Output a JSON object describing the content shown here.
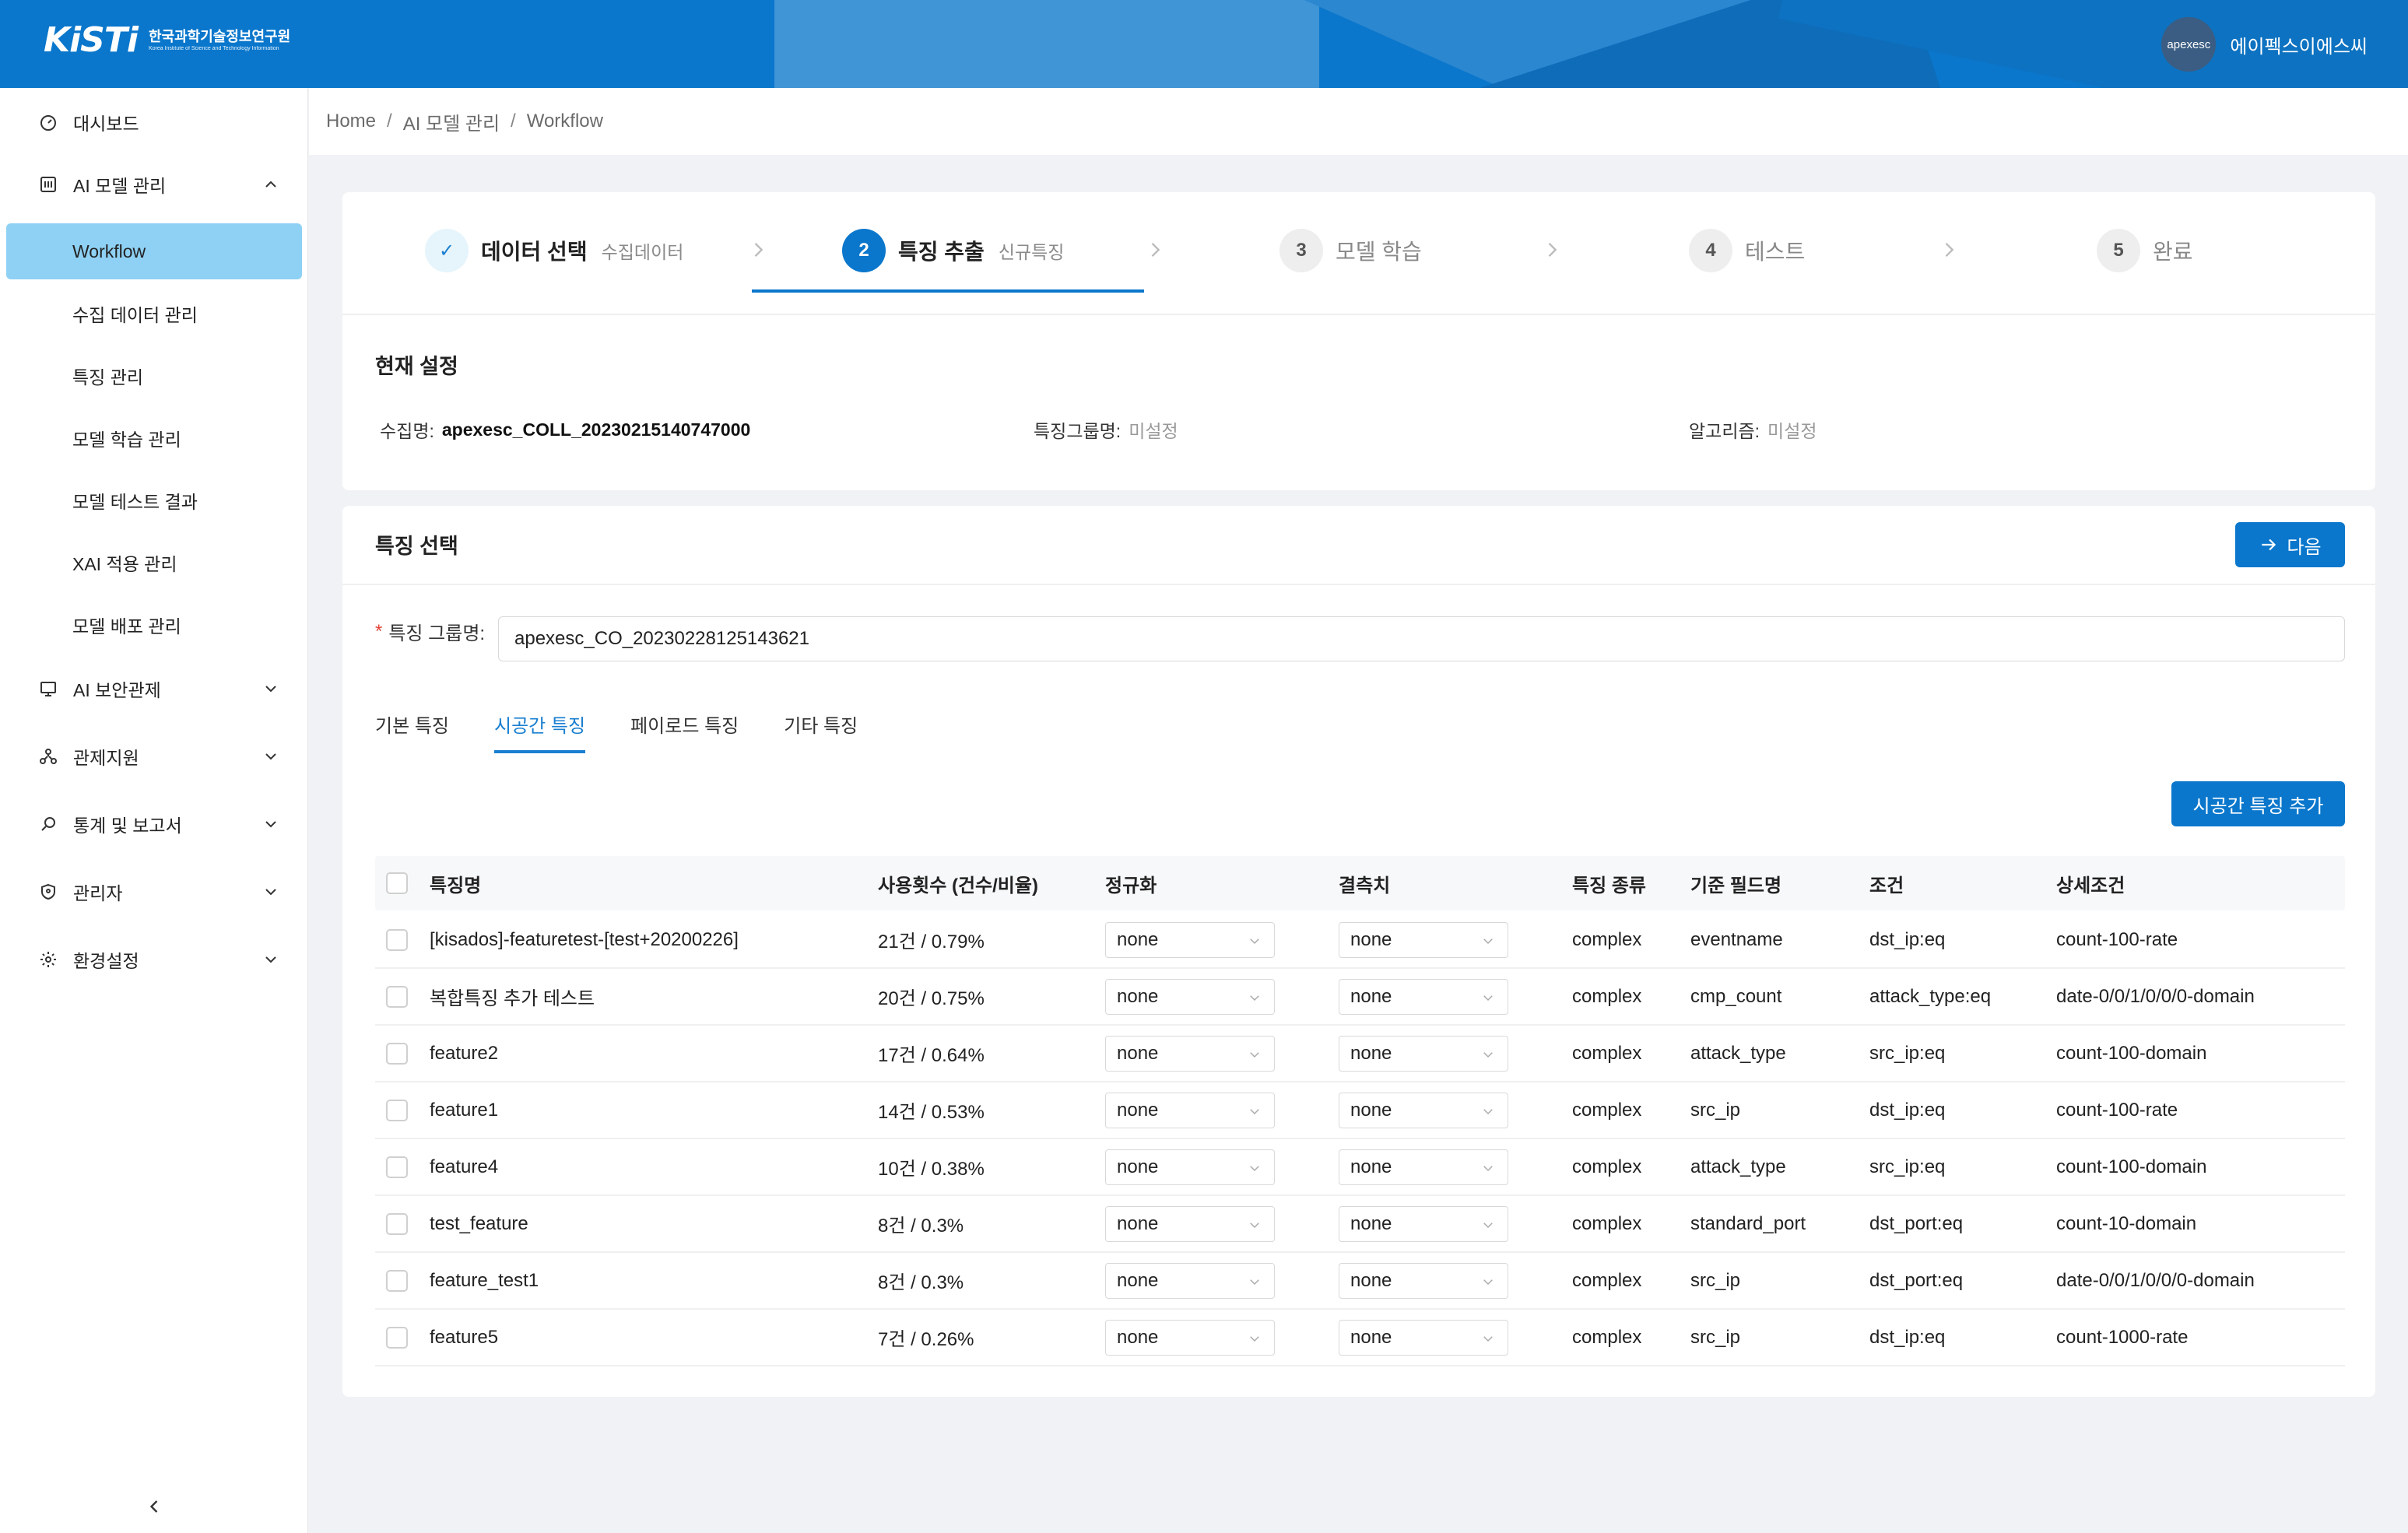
{
  "header": {
    "logo_mark": "KiSTi",
    "logo_korean": "한국과학기술정보연구원",
    "logo_english": "Korea Institute of Science and Technology Information",
    "avatar_text": "apexesc",
    "user_name": "에이펙스이에스씨"
  },
  "sidebar": {
    "items": [
      {
        "label": "대시보드",
        "icon": "dashboard-icon"
      },
      {
        "label": "AI 모델 관리",
        "icon": "ai-model-icon",
        "expanded": true
      },
      {
        "label": "AI 보안관제",
        "icon": "monitor-icon"
      },
      {
        "label": "관제지원",
        "icon": "network-icon"
      },
      {
        "label": "통계 및 보고서",
        "icon": "search-report-icon"
      },
      {
        "label": "관리자",
        "icon": "shield-icon"
      },
      {
        "label": "환경설정",
        "icon": "gear-icon"
      }
    ],
    "sub_items": [
      {
        "label": "Workflow",
        "active": true
      },
      {
        "label": "수집 데이터 관리"
      },
      {
        "label": "특징 관리"
      },
      {
        "label": "모델 학습 관리"
      },
      {
        "label": "모델 테스트 결과"
      },
      {
        "label": "XAI 적용 관리"
      },
      {
        "label": "모델 배포 관리"
      }
    ]
  },
  "breadcrumb": [
    "Home",
    "AI 모델 관리",
    "Workflow"
  ],
  "steps": [
    {
      "num": "✓",
      "title": "데이터 선택",
      "desc": "수집데이터",
      "state": "done"
    },
    {
      "num": "2",
      "title": "특징 추출",
      "desc": "신규특징",
      "state": "active"
    },
    {
      "num": "3",
      "title": "모델 학습",
      "desc": "",
      "state": "wait"
    },
    {
      "num": "4",
      "title": "테스트",
      "desc": "",
      "state": "wait"
    },
    {
      "num": "5",
      "title": "완료",
      "desc": "",
      "state": "wait"
    }
  ],
  "current_settings": {
    "title": "현재 설정",
    "collection_label": "수집명:",
    "collection_value": "apexesc_COLL_20230215140747000",
    "feature_group_label": "특징그룹명:",
    "feature_group_value": "미설정",
    "algorithm_label": "알고리즘:",
    "algorithm_value": "미설정"
  },
  "feature_select": {
    "title": "특징 선택",
    "next_button": "다음",
    "group_label": "특징 그룹명:",
    "group_value": "apexesc_CO_20230228125143621",
    "tabs": [
      "기본 특징",
      "시공간 특징",
      "페이로드 특징",
      "기타 특징"
    ],
    "active_tab": 1,
    "add_button": "시공간 특징 추가"
  },
  "table": {
    "columns": [
      "특징명",
      "사용횟수 (건수/비율)",
      "정규화",
      "결측치",
      "특징 종류",
      "기준 필드명",
      "조건",
      "상세조건"
    ],
    "rows": [
      {
        "name": "[kisados]-featuretest-[test+20200226]",
        "usage": "21건 / 0.79%",
        "norm": "none",
        "missing": "none",
        "kind": "complex",
        "field": "eventname",
        "cond": "dst_ip:eq",
        "detail": "count-100-rate"
      },
      {
        "name": "복합특징 추가 테스트",
        "usage": "20건 / 0.75%",
        "norm": "none",
        "missing": "none",
        "kind": "complex",
        "field": "cmp_count",
        "cond": "attack_type:eq",
        "detail": "date-0/0/1/0/0/0-domain"
      },
      {
        "name": "feature2",
        "usage": "17건 / 0.64%",
        "norm": "none",
        "missing": "none",
        "kind": "complex",
        "field": "attack_type",
        "cond": "src_ip:eq",
        "detail": "count-100-domain"
      },
      {
        "name": "feature1",
        "usage": "14건 / 0.53%",
        "norm": "none",
        "missing": "none",
        "kind": "complex",
        "field": "src_ip",
        "cond": "dst_ip:eq",
        "detail": "count-100-rate"
      },
      {
        "name": "feature4",
        "usage": "10건 / 0.38%",
        "norm": "none",
        "missing": "none",
        "kind": "complex",
        "field": "attack_type",
        "cond": "src_ip:eq",
        "detail": "count-100-domain"
      },
      {
        "name": "test_feature",
        "usage": "8건 / 0.3%",
        "norm": "none",
        "missing": "none",
        "kind": "complex",
        "field": "standard_port",
        "cond": "dst_port:eq",
        "detail": "count-10-domain"
      },
      {
        "name": "feature_test1",
        "usage": "8건 / 0.3%",
        "norm": "none",
        "missing": "none",
        "kind": "complex",
        "field": "src_ip",
        "cond": "dst_port:eq",
        "detail": "date-0/0/1/0/0/0-domain"
      },
      {
        "name": "feature5",
        "usage": "7건 / 0.26%",
        "norm": "none",
        "missing": "none",
        "kind": "complex",
        "field": "src_ip",
        "cond": "dst_ip:eq",
        "detail": "count-1000-rate"
      }
    ]
  },
  "colors": {
    "primary": "#0a77cc",
    "active_menu": "#8ed1f4",
    "header_bg": "#0a77cc"
  }
}
